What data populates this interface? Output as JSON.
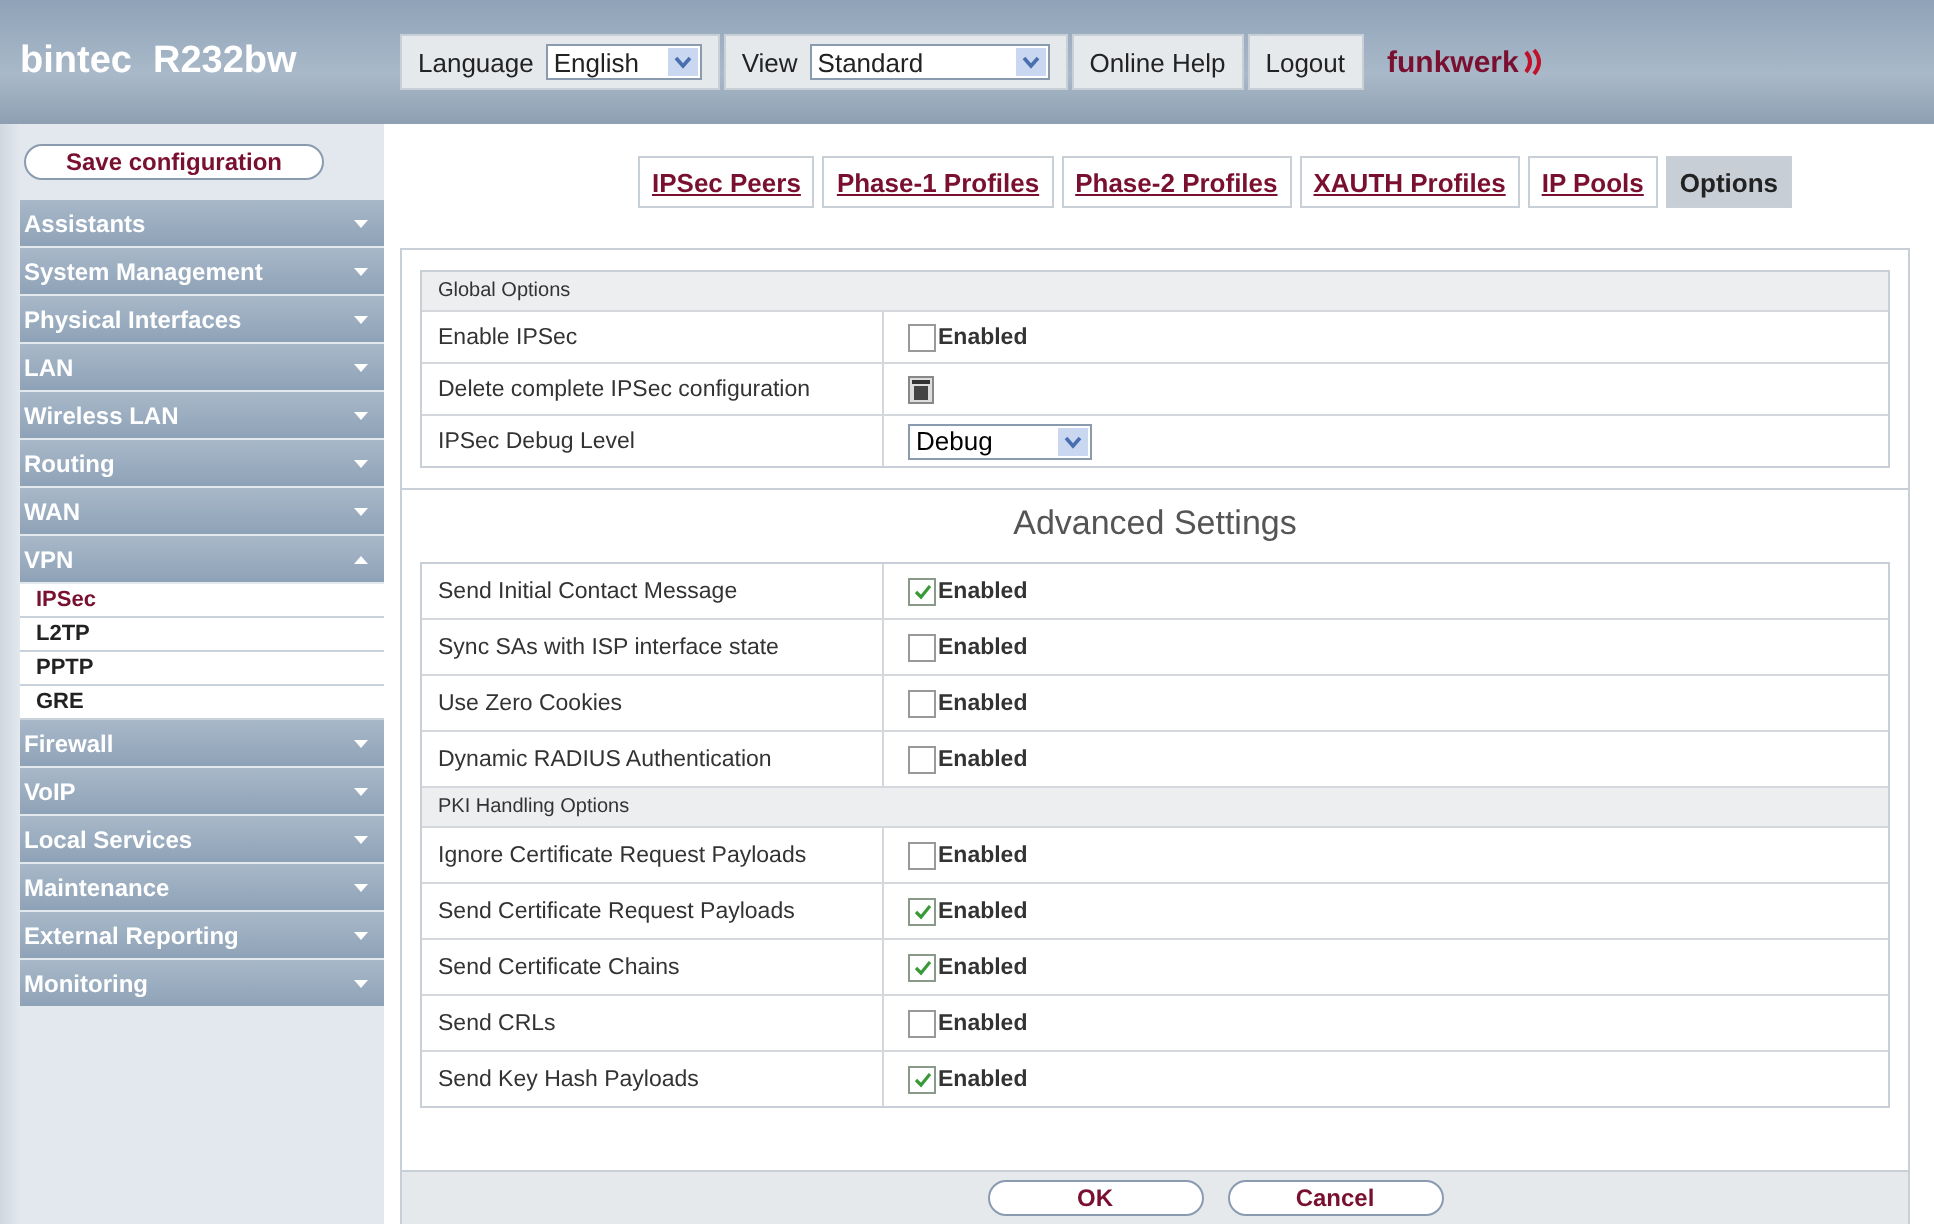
{
  "header": {
    "product": "bintec  R232bw",
    "language_label": "Language",
    "language": "English",
    "view_label": "View",
    "view": "Standard",
    "help": "Online Help",
    "logout": "Logout",
    "logo": "funkwerk"
  },
  "sidebar": {
    "save": "Save configuration",
    "items": [
      {
        "label": "Assistants",
        "expanded": false
      },
      {
        "label": "System Management",
        "expanded": false
      },
      {
        "label": "Physical Interfaces",
        "expanded": false
      },
      {
        "label": "LAN",
        "expanded": false
      },
      {
        "label": "Wireless LAN",
        "expanded": false
      },
      {
        "label": "Routing",
        "expanded": false
      },
      {
        "label": "WAN",
        "expanded": false
      },
      {
        "label": "VPN",
        "expanded": true,
        "children": [
          {
            "label": "IPSec",
            "selected": true
          },
          {
            "label": "L2TP",
            "selected": false
          },
          {
            "label": "PPTP",
            "selected": false
          },
          {
            "label": "GRE",
            "selected": false
          }
        ]
      },
      {
        "label": "Firewall",
        "expanded": false
      },
      {
        "label": "VoIP",
        "expanded": false
      },
      {
        "label": "Local Services",
        "expanded": false
      },
      {
        "label": "Maintenance",
        "expanded": false
      },
      {
        "label": "External Reporting",
        "expanded": false
      },
      {
        "label": "Monitoring",
        "expanded": false
      }
    ]
  },
  "tabs": [
    {
      "label": "IPSec Peers",
      "selected": false
    },
    {
      "label": "Phase-1 Profiles",
      "selected": false
    },
    {
      "label": "Phase-2 Profiles",
      "selected": false
    },
    {
      "label": "XAUTH Profiles",
      "selected": false
    },
    {
      "label": "IP Pools",
      "selected": false
    },
    {
      "label": "Options",
      "selected": true
    }
  ],
  "blocks": [
    {
      "kind": "group",
      "title": "Global Options",
      "rows": [
        {
          "kind": "checkbox",
          "label": "Enable IPSec",
          "checked": false,
          "text": "Enabled"
        },
        {
          "kind": "delete",
          "label": "Delete complete IPSec configuration"
        },
        {
          "kind": "select",
          "label": "IPSec Debug Level",
          "value": "Debug"
        }
      ]
    },
    {
      "kind": "heading",
      "title": "Advanced Settings"
    },
    {
      "kind": "table",
      "rows": [
        {
          "kind": "checkbox",
          "label": "Send Initial Contact Message",
          "checked": true,
          "text": "Enabled"
        },
        {
          "kind": "checkbox",
          "label": "Sync SAs with ISP interface state",
          "checked": false,
          "text": "Enabled"
        },
        {
          "kind": "checkbox",
          "label": "Use Zero Cookies",
          "checked": false,
          "text": "Enabled"
        },
        {
          "kind": "checkbox",
          "label": "Dynamic RADIUS Authentication",
          "checked": false,
          "text": "Enabled"
        },
        {
          "kind": "subheader",
          "label": "PKI Handling Options"
        },
        {
          "kind": "checkbox",
          "label": "Ignore Certificate Request Payloads",
          "checked": false,
          "text": "Enabled"
        },
        {
          "kind": "checkbox",
          "label": "Send Certificate Request Payloads",
          "checked": true,
          "text": "Enabled"
        },
        {
          "kind": "checkbox",
          "label": "Send Certificate Chains",
          "checked": true,
          "text": "Enabled"
        },
        {
          "kind": "checkbox",
          "label": "Send CRLs",
          "checked": false,
          "text": "Enabled"
        },
        {
          "kind": "checkbox",
          "label": "Send Key Hash Payloads",
          "checked": true,
          "text": "Enabled"
        }
      ]
    }
  ],
  "buttons": [
    "OK",
    "Cancel"
  ]
}
